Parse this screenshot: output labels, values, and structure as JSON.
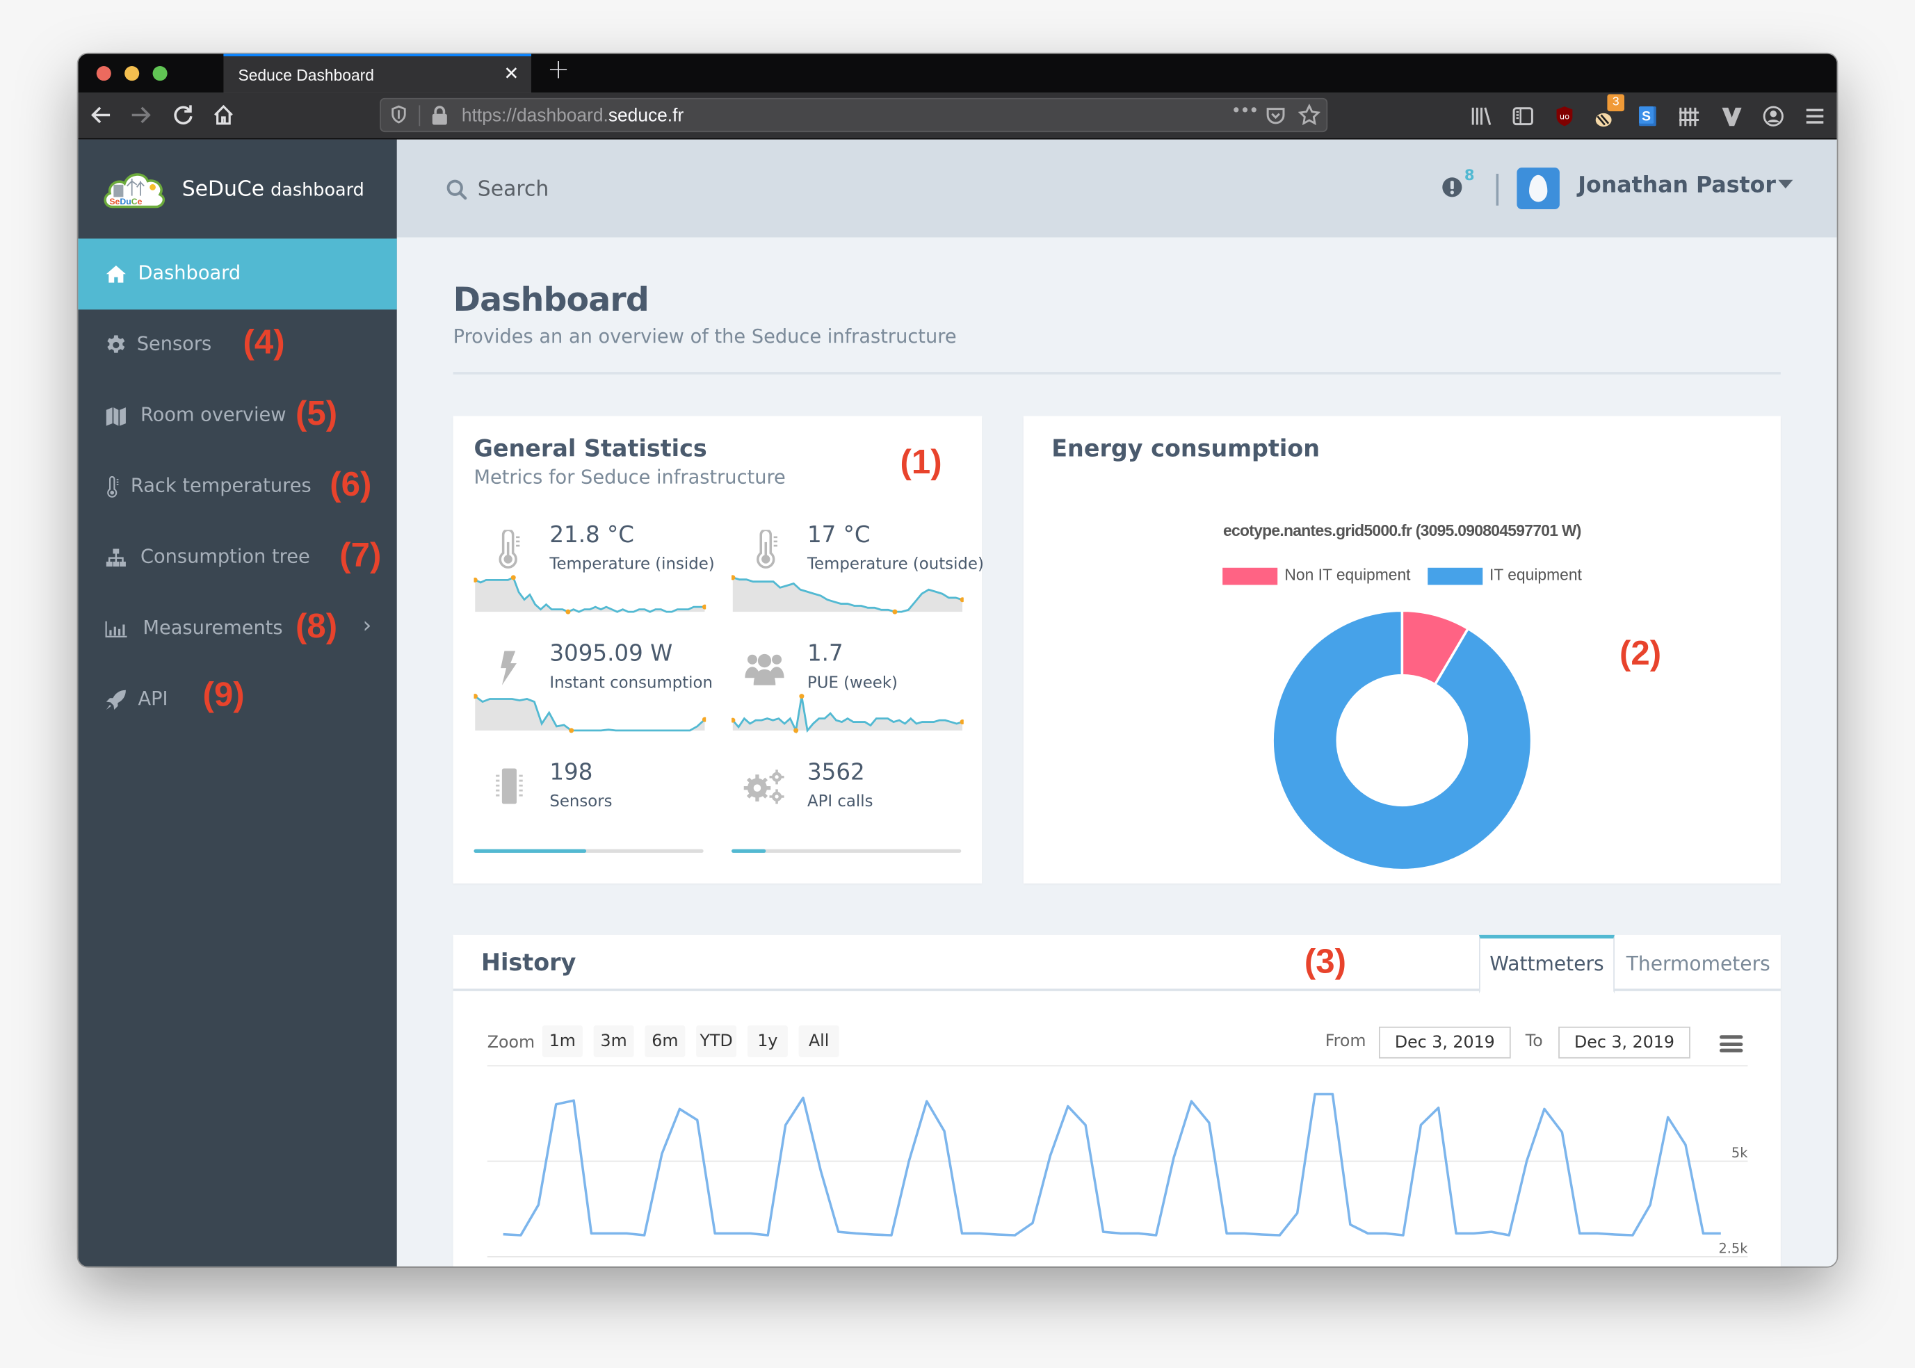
{
  "browser": {
    "tab_title": "Seduce Dashboard",
    "tab_close": "✕",
    "new_tab": "+",
    "url_prefix": "https://dashboard.",
    "url_domain": "seduce.fr",
    "url_more": "•••",
    "extension_badge": "3"
  },
  "sidebar": {
    "brand_main": "SeDuCe",
    "brand_sub": "dashboard",
    "logo_text": "SeDuCe",
    "items": [
      {
        "label": "Dashboard",
        "icon": "home-icon",
        "active": true,
        "annotation": ""
      },
      {
        "label": "Sensors",
        "icon": "gear-icon",
        "active": false,
        "annotation": "(4)"
      },
      {
        "label": "Room overview",
        "icon": "map-icon",
        "active": false,
        "annotation": "(5)"
      },
      {
        "label": "Rack temperatures",
        "icon": "thermometer-icon",
        "active": false,
        "annotation": "(6)"
      },
      {
        "label": "Consumption tree",
        "icon": "sitemap-icon",
        "active": false,
        "annotation": "(7)"
      },
      {
        "label": "Measurements",
        "icon": "bar-chart-icon",
        "active": false,
        "annotation": "(8)",
        "chevron": "›"
      },
      {
        "label": "API",
        "icon": "rocket-icon",
        "active": false,
        "annotation": "(9)"
      }
    ]
  },
  "topbar": {
    "search_placeholder": "Search",
    "alert_count": "8",
    "user_name": "Jonathan Pastor"
  },
  "page": {
    "title": "Dashboard",
    "subtitle": "Provides an an overview of the Seduce infrastructure"
  },
  "general_stats": {
    "title": "General Statistics",
    "subtitle": "Metrics for Seduce infrastructure",
    "annotation": "(1)",
    "stats": [
      {
        "value": "21.8 °C",
        "label": "Temperature (inside)",
        "icon": "thermometer-icon",
        "sparkline": [
          22.4,
          22.3,
          22.4,
          22.4,
          22.4,
          22.4,
          22.4,
          22.5,
          21.9,
          21.6,
          21.8,
          21.4,
          21.2,
          21.4,
          21.2,
          21.2,
          21.2,
          21.1,
          21.2,
          21.1,
          21.2,
          21.2,
          21.3,
          21.2,
          21.3,
          21.2,
          21.1,
          21.2,
          21.1,
          21.1,
          21.2,
          21.2,
          21.1,
          21.2,
          21.2,
          21.1,
          21.1,
          21.2,
          21.2,
          21.2,
          21.3,
          21.3,
          21.3
        ]
      },
      {
        "value": "17 °C",
        "label": "Temperature (outside)",
        "icon": "thermometer-icon",
        "sparkline": [
          18.2,
          18.1,
          18.1,
          18.0,
          18.0,
          18.0,
          18.0,
          17.7,
          17.8,
          17.9,
          17.6,
          17.5,
          17.4,
          17.3,
          17.1,
          17.0,
          16.9,
          16.9,
          16.8,
          16.8,
          16.7,
          16.7,
          16.6,
          16.6,
          16.5,
          16.5,
          16.6,
          17.0,
          17.4,
          17.6,
          17.5,
          17.4,
          17.2,
          17.2,
          17.1
        ]
      },
      {
        "value": "3095.09 W",
        "label": "Instant consumption",
        "icon": "bolt-icon",
        "sparkline": [
          4300,
          4100,
          4200,
          4200,
          4200,
          4200,
          4150,
          4200,
          4100,
          3300,
          3700,
          3200,
          3250,
          3050,
          3050,
          3050,
          3050,
          3050,
          3080,
          3050,
          3050,
          3050,
          3050,
          3050,
          3050,
          3050,
          3050,
          3050,
          3050,
          3050,
          3200,
          3450
        ]
      },
      {
        "value": "1.7",
        "label": "PUE (week)",
        "icon": "users-icon",
        "sparkline": [
          1.72,
          1.68,
          1.73,
          1.7,
          1.72,
          1.72,
          1.73,
          1.72,
          1.73,
          1.7,
          1.73,
          1.66,
          1.86,
          1.66,
          1.7,
          1.73,
          1.73,
          1.76,
          1.72,
          1.71,
          1.73,
          1.71,
          1.71,
          1.71,
          1.69,
          1.73,
          1.73,
          1.73,
          1.71,
          1.72,
          1.7,
          1.73,
          1.7,
          1.71,
          1.71,
          1.71,
          1.72,
          1.72,
          1.71,
          1.7,
          1.71
        ]
      },
      {
        "value": "198",
        "label": "Sensors",
        "icon": "chip-icon",
        "progress": 0.49
      },
      {
        "value": "3562",
        "label": "API calls",
        "icon": "gears-icon",
        "progress": 0.15
      }
    ]
  },
  "energy": {
    "title": "Energy consumption",
    "annotation": "(2)"
  },
  "history": {
    "title": "History",
    "annotation": "(3)",
    "tabs": [
      "Wattmeters",
      "Thermometers"
    ],
    "active_tab": 0,
    "zoom_label": "Zoom",
    "zoom_buttons": [
      "1m",
      "3m",
      "6m",
      "YTD",
      "1y",
      "All"
    ],
    "from_label": "From",
    "from_value": "Dec 3, 2019",
    "to_label": "To",
    "to_value": "Dec 3, 2019"
  },
  "chart_data": [
    {
      "type": "pie",
      "title": "ecotype.nantes.grid5000.fr (3095.090804597701 W)",
      "legend": "top",
      "categories": [
        "Non IT equipment",
        "IT equipment"
      ],
      "values": [
        0.085,
        0.915
      ],
      "colors": [
        "#ff6384",
        "#46a2e9"
      ],
      "inner_radius_ratio": 0.5
    },
    {
      "type": "line",
      "title": "",
      "xlabel": "",
      "ylabel": "",
      "ylim": [
        2500,
        7500
      ],
      "ytick_labels": [
        "2.5k",
        "5k"
      ],
      "yticks": [
        2500,
        5000,
        7500
      ],
      "grid": true,
      "color": "#7cb5ec",
      "series": [
        {
          "name": "Wattmeters",
          "values": [
            3085,
            3060,
            3860,
            6490,
            6590,
            3110,
            3110,
            3110,
            3060,
            5200,
            6370,
            6080,
            3110,
            3110,
            3110,
            3060,
            5950,
            6660,
            4740,
            3150,
            3110,
            3080,
            3060,
            5010,
            6570,
            5790,
            3110,
            3110,
            3080,
            3060,
            3380,
            5140,
            6440,
            5950,
            3150,
            3110,
            3110,
            3060,
            5100,
            6570,
            6010,
            3110,
            3110,
            3080,
            3060,
            3640,
            6760,
            6760,
            3340,
            3110,
            3110,
            3060,
            5950,
            6400,
            3110,
            3110,
            3150,
            3060,
            5010,
            6370,
            5760,
            3110,
            3110,
            3080,
            3060,
            3860,
            6150,
            5430,
            3110,
            3110
          ]
        }
      ]
    }
  ]
}
